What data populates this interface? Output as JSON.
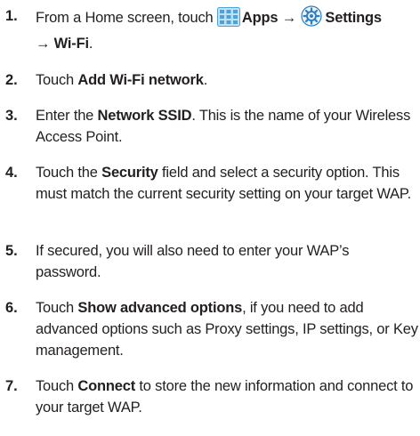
{
  "steps": [
    {
      "number": "1.",
      "segments": {
        "s1": "From a Home screen, touch ",
        "s2": "Apps",
        "s3": " → ",
        "s4": "Settings",
        "s5": "→ Wi-Fi",
        "s6": "."
      },
      "icons": [
        "apps-grid-icon",
        "settings-gear-icon"
      ]
    },
    {
      "number": "2.",
      "segments": {
        "s1": "Touch ",
        "s2": "Add Wi-Fi network",
        "s3": "."
      }
    },
    {
      "number": "3.",
      "segments": {
        "s1": "Enter the ",
        "s2": "Network SSID",
        "s3": ". This is the name of your Wireless Access Point."
      }
    },
    {
      "number": "4.",
      "segments": {
        "s1": "Touch the ",
        "s2": "Security",
        "s3": " field and select a security option. This must match the current security setting on your target WAP."
      }
    },
    {
      "number": "5.",
      "segments": {
        "s1": "If secured, you will also need to enter your WAP’s password."
      }
    },
    {
      "number": "6.",
      "segments": {
        "s1": "Touch ",
        "s2": "Show advanced options",
        "s3": ", if you need to add advanced options such as Proxy settings, IP settings, or Key management."
      }
    },
    {
      "number": "7.",
      "segments": {
        "s1": "Touch ",
        "s2": "Connect",
        "s3": " to store the new information and connect to your target WAP."
      }
    }
  ],
  "colors": {
    "text": "#231f20",
    "apps_icon": "#4da3d8",
    "settings_icon": "#2f7fc1"
  }
}
